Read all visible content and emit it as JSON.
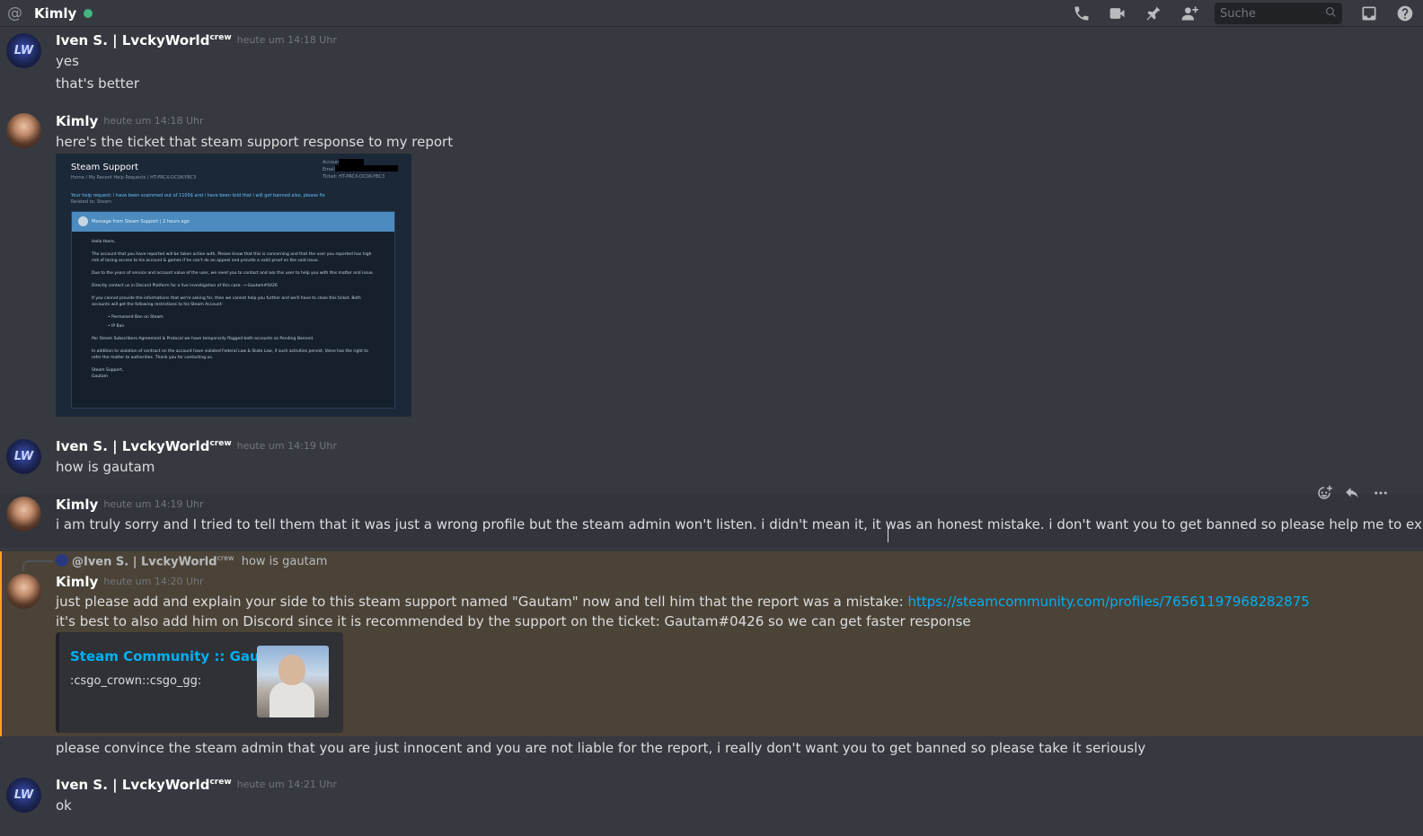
{
  "header": {
    "title": "Kimly",
    "search_placeholder": "Suche",
    "icons": [
      "at-icon",
      "call-icon",
      "video-icon",
      "pin-icon",
      "add-friend-icon",
      "search-icon",
      "inbox-icon",
      "help-icon"
    ]
  },
  "messages": [
    {
      "author": "Iven S. | LvckyWorld",
      "tag": "crew",
      "timestamp": "heute um 14:18 Uhr",
      "lines": [
        "yes",
        "that's better"
      ]
    },
    {
      "author": "Kimly",
      "timestamp": "heute um 14:18 Uhr",
      "lines": [
        "here's the ticket that steam support response to my report"
      ],
      "attachment": {
        "title": "Steam Support",
        "crumb": "Home / My Recent Help Requests / HT-PRCX-DCDK-YBC3",
        "account_lines": [
          "Account:",
          "Email:",
          "Ticket: HT-PRCX-DCDK-YBC3"
        ],
        "help_request": "Your help request: i have been scammed out of 1100$ and i have been told that i will get banned also, please fix",
        "related": "Related to: Steam",
        "box_head": "Message from Steam Support | 2 hours ago",
        "body": [
          "Hello there,",
          "The account that you have reported will be taken action with. Please know that this is concerning and that the user you reported has high risk of losing access to his account & games if he can't do an appeal and provide a valid proof on the said issue.",
          "Due to the years of service and account value of the user, we need you to contact and ask this user to help you with this matter and issue.",
          "Directly contact us in Discord Platform for a live investigation of this case. → Gautam#0426",
          "If you cannot provide the informations that we're asking for, then we cannot help you further and we'll have to close this ticket. Both accounts will get the following restrictions to his Steam Account:",
          "• Permanent Ban on Steam",
          "• IP Ban",
          "Per Steam Subscribers Agreement & Protocol we have temporarily flagged both accounts as Pending Banned.",
          "In addition to violation of contract on the account have violated Federal Law & State Law, if such activities persist, Valve has the right to refer the matter to authorities. Thank you for contacting us.",
          "Steam Support,",
          "Gautam"
        ]
      }
    },
    {
      "author": "Iven S. | LvckyWorld",
      "tag": "crew",
      "timestamp": "heute um 14:19 Uhr",
      "lines": [
        "how is gautam"
      ]
    },
    {
      "author": "Kimly",
      "timestamp": "heute um 14:19 Uhr",
      "lines": [
        "i am truly sorry and I tried to tell them that it was just a wrong profile but the steam admin won't listen. i didn't mean it, it was an honest mistake. i don't want you to get banned so please help me to explain it"
      ]
    },
    {
      "author": "Kimly",
      "timestamp": "heute um 14:20 Uhr",
      "reply": {
        "mention": "@Iven S. | LvckyWorld",
        "tag": "crew",
        "text": "how is gautam"
      },
      "line1_prefix": "just please add and explain your side to this steam support named \"Gautam\" now and tell him that the report was a mistake: ",
      "link": "https://steamcommunity.com/profiles/76561197968282875",
      "line2": "it's best to also add him on Discord since it is recommended by the support on the ticket: Gautam#0426 so we can get faster response",
      "embed": {
        "title": "Steam Community :: Gautam",
        "description": ":csgo_crown::csgo_gg:"
      },
      "line3": "please convince the steam admin that you are just innocent and you are not liable for the report, i really don't want you to get banned so please take it seriously"
    },
    {
      "author": "Iven S. | LvckyWorld",
      "tag": "crew",
      "timestamp": "heute um 14:21 Uhr",
      "lines": [
        "ok"
      ]
    }
  ],
  "hover_actions": [
    "add-reaction-icon",
    "reply-icon",
    "more-icon"
  ],
  "colors": {
    "background": "#36393f",
    "link": "#00b0f4",
    "mention_highlight": "#4b4337",
    "online": "#43b581"
  }
}
